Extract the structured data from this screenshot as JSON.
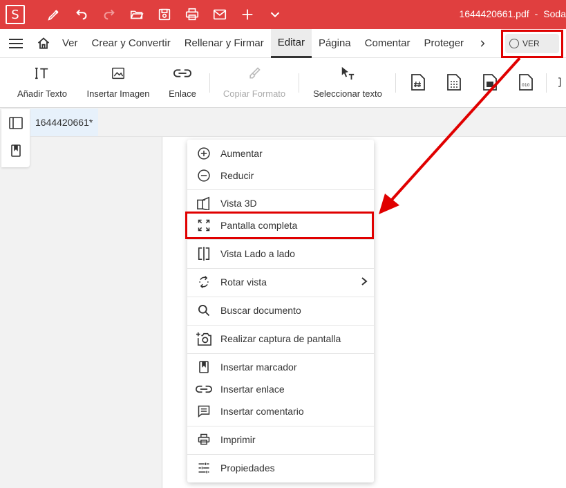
{
  "app": {
    "logo_letter": "S",
    "window_title_file": "1644420661.pdf",
    "window_title_sep": "-",
    "window_title_app": "Soda",
    "accent_color": "#e03f3f",
    "highlight_color": "#e00000"
  },
  "quick_access": [
    "pen-icon",
    "undo-icon",
    "redo-icon",
    "open-folder-icon",
    "save-icon",
    "print-icon",
    "email-icon",
    "plus-icon",
    "chevron-down-icon"
  ],
  "menubar": {
    "tabs": [
      {
        "label": "Ver"
      },
      {
        "label": "Crear y Convertir"
      },
      {
        "label": "Rellenar y Firmar"
      },
      {
        "label": "Editar"
      },
      {
        "label": "Página"
      },
      {
        "label": "Comentar"
      },
      {
        "label": "Proteger"
      }
    ],
    "active_tab": "Editar",
    "view_toggle_label": "VER"
  },
  "toolbar": {
    "add_text": "Añadir Texto",
    "insert_image": "Insertar Imagen",
    "link": "Enlace",
    "copy_format": "Copiar Formato",
    "select_text": "Seleccionar texto"
  },
  "document": {
    "tab_name": "1644420661*"
  },
  "context_menu": {
    "zoom_in": "Aumentar",
    "zoom_out": "Reducir",
    "view_3d": "Vista 3D",
    "full_screen": "Pantalla completa",
    "side_by_side": "Vista Lado a lado",
    "rotate_view": "Rotar vista",
    "search_document": "Buscar documento",
    "screenshot": "Realizar captura de pantalla",
    "insert_bookmark": "Insertar marcador",
    "insert_link": "Insertar enlace",
    "insert_comment": "Insertar comentario",
    "print": "Imprimir",
    "properties": "Propiedades"
  }
}
